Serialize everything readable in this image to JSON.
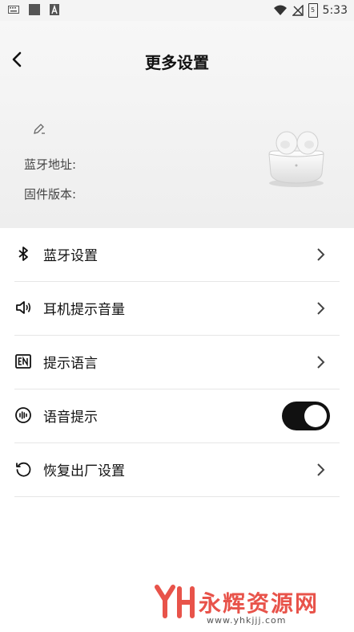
{
  "status_bar": {
    "time": "5:33",
    "battery_level": "5"
  },
  "header": {
    "title": "更多设置",
    "bt_address_label": "蓝牙地址:",
    "fw_version_label": "固件版本:"
  },
  "settings": {
    "bluetooth": "蓝牙设置",
    "volume": "耳机提示音量",
    "language": "提示语言",
    "voice_prompt": "语音提示",
    "voice_prompt_on": true,
    "factory_reset": "恢复出厂设置"
  },
  "icons": [
    "back-icon",
    "edit-icon",
    "bluetooth-icon",
    "speaker-icon",
    "en-language-icon",
    "voice-waveform-icon",
    "reset-icon",
    "chevron-right-icon"
  ],
  "watermark": {
    "brand": "永辉资源网",
    "url": "www.yhkjjj.com",
    "color": "#e8534a"
  }
}
